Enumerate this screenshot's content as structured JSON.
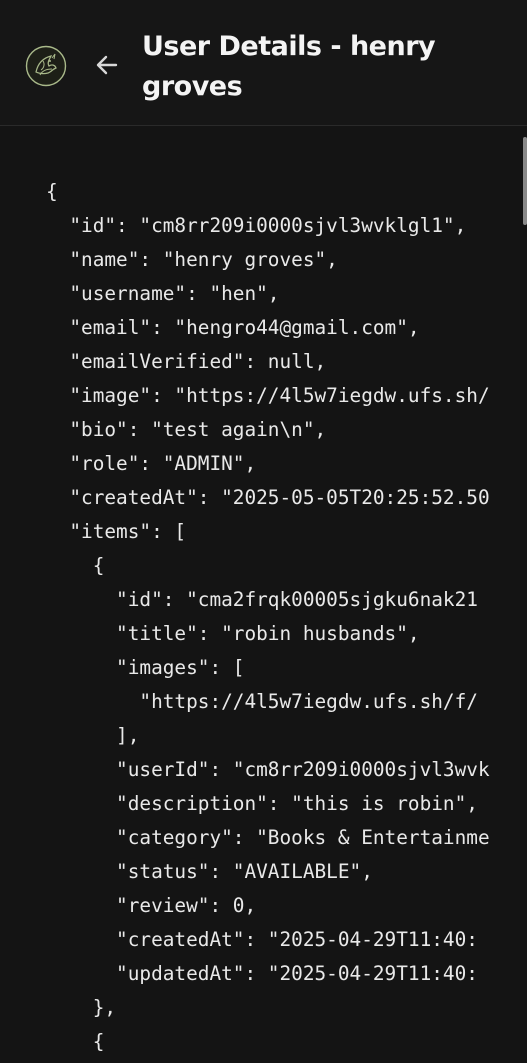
{
  "header": {
    "title": "User Details - henry groves",
    "logo_icon": "wolf-leaf-emblem-icon",
    "back_icon": "arrow-left-icon"
  },
  "json_view": {
    "lines": [
      "{",
      "  \"id\": \"cm8rr209i0000sjvl3wvklgl1\",",
      "  \"name\": \"henry groves\",",
      "  \"username\": \"hen\",",
      "  \"email\": \"hengro44@gmail.com\",",
      "  \"emailVerified\": null,",
      "  \"image\": \"https://4l5w7iegdw.ufs.sh/",
      "  \"bio\": \"test again\\n\",",
      "  \"role\": \"ADMIN\",",
      "  \"createdAt\": \"2025-05-05T20:25:52.50",
      "  \"items\": [",
      "    {",
      "      \"id\": \"cma2frqk00005sjgku6nak21",
      "      \"title\": \"robin husbands\",",
      "      \"images\": [",
      "        \"https://4l5w7iegdw.ufs.sh/f/",
      "      ],",
      "      \"userId\": \"cm8rr209i0000sjvl3wvk",
      "      \"description\": \"this is robin\",",
      "      \"category\": \"Books & Entertainme",
      "      \"status\": \"AVAILABLE\",",
      "      \"review\": 0,",
      "      \"createdAt\": \"2025-04-29T11:40:",
      "      \"updatedAt\": \"2025-04-29T11:40:",
      "    },",
      "    {"
    ]
  },
  "colors": {
    "background": "#141414",
    "header_background": "#161616",
    "text": "#e9e9e9",
    "logo_accent": "#a9b98a"
  }
}
